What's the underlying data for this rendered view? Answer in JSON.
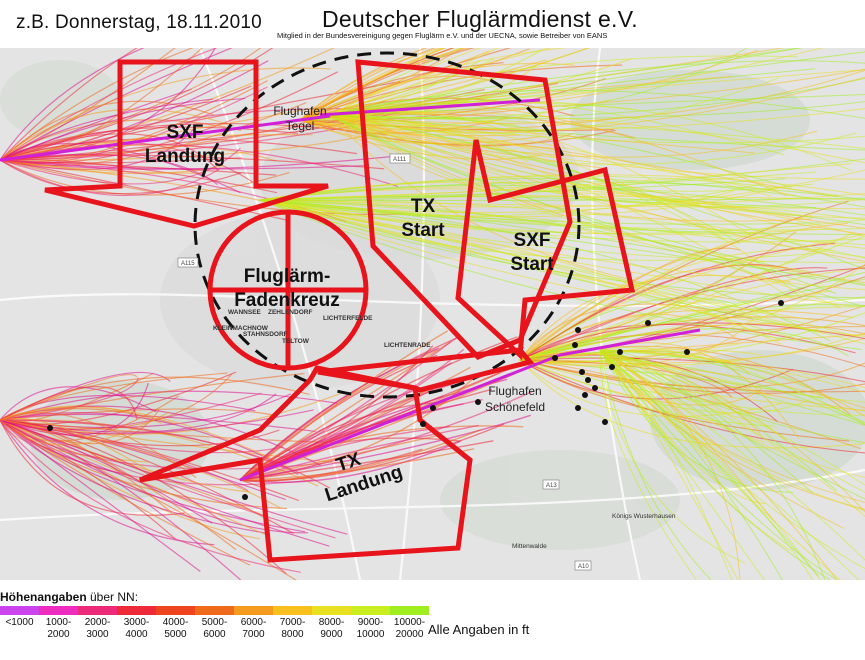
{
  "header": {
    "date_label": "z.B. Donnerstag, 18.11.2010",
    "title": "Deutscher Fluglärmdienst e.V.",
    "subtitle": "Mitglied in der Bundesvereinigung gegen Fluglärm e.V. und der UECNA, sowie Betreiber von EANS"
  },
  "map": {
    "zones": {
      "sxf_landing": [
        "SXF",
        "Landung"
      ],
      "tx_start": [
        "TX",
        "Start"
      ],
      "sxf_start": [
        "SXF",
        "Start"
      ],
      "tx_landing": [
        "TX",
        "Landung"
      ],
      "crosshair": [
        "Fluglärm-",
        "Fadenkreuz"
      ]
    },
    "airports": {
      "tegel": [
        "Flughafen",
        "Tegel"
      ],
      "schoenefeld": [
        "Flughafen",
        "Schönefeld"
      ]
    },
    "places": {
      "wannsee": "WANNSEE",
      "zehlendorf": "ZEHLENDORF",
      "lichterfelde": "LICHTERFELDE",
      "kleinmachnow": "KLEINMACHNOW",
      "stahnsdorf": "STAHNSDORF",
      "teltow": "TELTOW",
      "lichtenrade": "LICHTENRADE",
      "mittenwalde": "Mittenwalde",
      "koenigs_wusterhausen": "Königs Wusterhausen",
      "a10": "A10",
      "a13": "A13",
      "a111": "A111",
      "a115": "A115"
    },
    "colors": {
      "zone_outline": "#e8141c",
      "ring_dash": "#111111",
      "map_bg": "#e6e6e6",
      "forest": "#bfcfbf",
      "track_low": "#e01090",
      "track_mid": "#f05a28",
      "track_high": "#c8e000"
    },
    "dot_color": "#111111"
  },
  "legend": {
    "title_bold": "Höhenangaben",
    "title_rest": " über NN:",
    "bins": [
      {
        "label": "<1000",
        "color": "#cc44ee"
      },
      {
        "label": "1000-\n2000",
        "color": "#ee2cc0"
      },
      {
        "label": "2000-\n3000",
        "color": "#ee2a7a"
      },
      {
        "label": "3000-\n4000",
        "color": "#ee2a38"
      },
      {
        "label": "4000-\n5000",
        "color": "#ee4420"
      },
      {
        "label": "5000-\n6000",
        "color": "#f06a1c"
      },
      {
        "label": "6000-\n7000",
        "color": "#f49a1c"
      },
      {
        "label": "7000-\n8000",
        "color": "#f8c01c"
      },
      {
        "label": "8000-\n9000",
        "color": "#e8e020"
      },
      {
        "label": "9000-\n10000",
        "color": "#c8ee20"
      },
      {
        "label": "10000-\n20000",
        "color": "#a0ee20"
      }
    ],
    "note": "Alle Angaben in ft"
  }
}
